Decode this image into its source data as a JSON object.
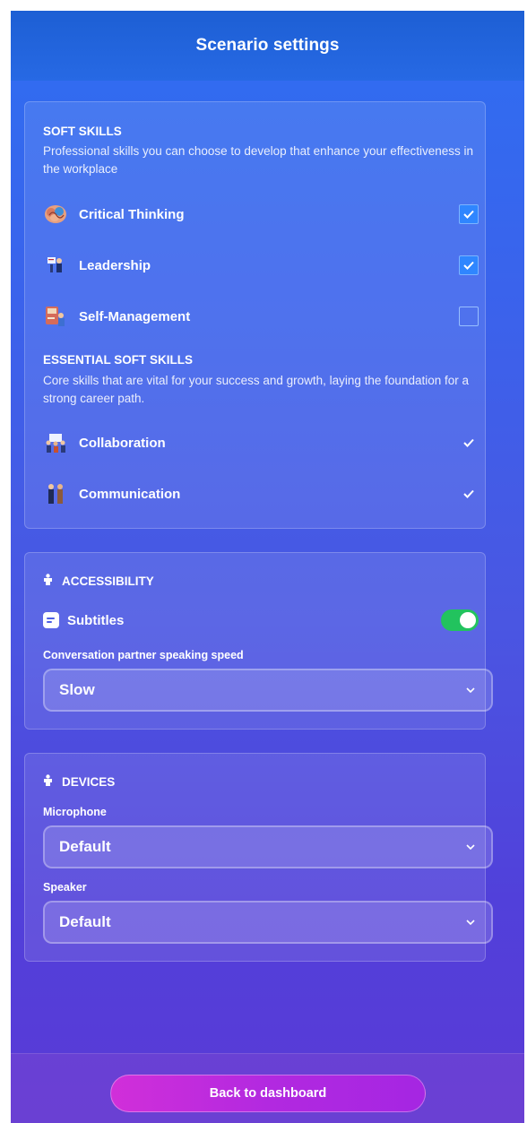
{
  "header": {
    "title": "Scenario settings"
  },
  "soft_skills": {
    "title": "SOFT SKILLS",
    "description": "Professional skills you can choose to develop that enhance your effectiveness in the workplace",
    "items": [
      {
        "label": "Critical Thinking",
        "icon": "brain-icon",
        "checked": true
      },
      {
        "label": "Leadership",
        "icon": "leadership-icon",
        "checked": true
      },
      {
        "label": "Self-Management",
        "icon": "self-management-icon",
        "checked": false
      }
    ]
  },
  "essential_soft_skills": {
    "title": "ESSENTIAL SOFT SKILLS",
    "description": "Core skills that are vital for your success and growth, laying the foundation for a strong career path.",
    "items": [
      {
        "label": "Collaboration",
        "icon": "collaboration-icon"
      },
      {
        "label": "Communication",
        "icon": "communication-icon"
      }
    ]
  },
  "accessibility": {
    "title": "ACCESSIBILITY",
    "subtitles_label": "Subtitles",
    "subtitles_on": true,
    "speed_label": "Conversation partner speaking speed",
    "speed_value": "Slow"
  },
  "devices": {
    "title": "DEVICES",
    "microphone_label": "Microphone",
    "microphone_value": "Default",
    "speaker_label": "Speaker",
    "speaker_value": "Default"
  },
  "footer": {
    "back_label": "Back to dashboard"
  },
  "colors": {
    "header_bg": "#1d5fd4",
    "checkbox_checked": "#2f86ff",
    "toggle_on": "#22c35e",
    "button_gradient_start": "#d12fd9",
    "button_gradient_end": "#a526e2"
  }
}
